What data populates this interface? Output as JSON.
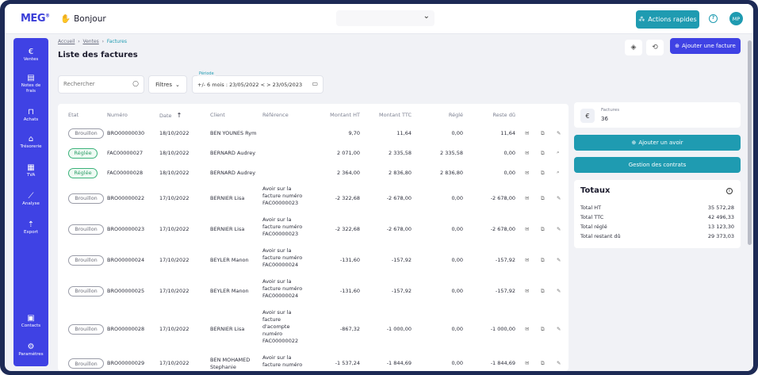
{
  "topbar": {
    "logo": "MEG",
    "greeting": "Bonjour",
    "quick_actions_label": "Actions rapides",
    "avatar_initials": "MP"
  },
  "sidebar": {
    "items": [
      {
        "label": "Ventes",
        "icon": "euro-icon",
        "glyph": "€"
      },
      {
        "label": "Notes de frais",
        "icon": "receipt-icon",
        "glyph": "▤"
      },
      {
        "label": "Achats",
        "icon": "bag-icon",
        "glyph": "⊓"
      },
      {
        "label": "Trésorerie",
        "icon": "bank-icon",
        "glyph": "⌂"
      },
      {
        "label": "TVA",
        "icon": "document-icon",
        "glyph": "▦"
      },
      {
        "label": "Analyse",
        "icon": "chart-icon",
        "glyph": "⟋"
      },
      {
        "label": "Export",
        "icon": "upload-icon",
        "glyph": "⇡"
      },
      {
        "label": "Contacts",
        "icon": "contacts-icon",
        "glyph": "▣"
      },
      {
        "label": "Paramètres",
        "icon": "settings-icon",
        "glyph": "⚙"
      }
    ]
  },
  "breadcrumb": {
    "home": "Accueil",
    "section": "Ventes",
    "current": "Factures"
  },
  "page_title": "Liste des factures",
  "add_invoice_label": "Ajouter une facture",
  "filters": {
    "search_placeholder": "Rechercher",
    "filters_label": "Filtres",
    "period_label": "Période",
    "period_value": "+/- 6 mois : 23/05/2022 < > 23/05/2023"
  },
  "table": {
    "headers": {
      "etat": "Etat",
      "numero": "Numéro",
      "date": "Date",
      "client": "Client",
      "reference": "Référence",
      "ht": "Montant HT",
      "ttc": "Montant TTC",
      "regle": "Réglé",
      "reste": "Reste dû"
    },
    "rows": [
      {
        "etat": "Brouillon",
        "status": "draft",
        "numero": "BRO00000030",
        "date": "18/10/2022",
        "client": "BEN YOUNES Rym",
        "reference": "",
        "ht": "9,70",
        "ttc": "11,64",
        "regle": "0,00",
        "reste": "11,64"
      },
      {
        "etat": "Réglée",
        "status": "paid",
        "numero": "FAC00000027",
        "date": "18/10/2022",
        "client": "BERNARD Audrey",
        "reference": "",
        "ht": "2 071,00",
        "ttc": "2 335,58",
        "regle": "2 335,58",
        "reste": "0,00"
      },
      {
        "etat": "Réglée",
        "status": "paid",
        "numero": "FAC00000028",
        "date": "18/10/2022",
        "client": "BERNARD Audrey",
        "reference": "",
        "ht": "2 364,00",
        "ttc": "2 836,80",
        "regle": "2 836,80",
        "reste": "0,00"
      },
      {
        "etat": "Brouillon",
        "status": "draft",
        "numero": "BRO00000022",
        "date": "17/10/2022",
        "client": "BERNIER Lisa",
        "reference": "Avoir sur la facture numéro FAC00000023",
        "ht": "-2 322,68",
        "ttc": "-2 678,00",
        "regle": "0,00",
        "reste": "-2 678,00"
      },
      {
        "etat": "Brouillon",
        "status": "draft",
        "numero": "BRO00000023",
        "date": "17/10/2022",
        "client": "BERNIER Lisa",
        "reference": "Avoir sur la facture numéro FAC00000023",
        "ht": "-2 322,68",
        "ttc": "-2 678,00",
        "regle": "0,00",
        "reste": "-2 678,00"
      },
      {
        "etat": "Brouillon",
        "status": "draft",
        "numero": "BRO00000024",
        "date": "17/10/2022",
        "client": "BEYLER Manon",
        "reference": "Avoir sur la facture numéro FAC00000024",
        "ht": "-131,60",
        "ttc": "-157,92",
        "regle": "0,00",
        "reste": "-157,92"
      },
      {
        "etat": "Brouillon",
        "status": "draft",
        "numero": "BRO00000025",
        "date": "17/10/2022",
        "client": "BEYLER Manon",
        "reference": "Avoir sur la facture numéro FAC00000024",
        "ht": "-131,60",
        "ttc": "-157,92",
        "regle": "0,00",
        "reste": "-157,92"
      },
      {
        "etat": "Brouillon",
        "status": "draft",
        "numero": "BRO00000028",
        "date": "17/10/2022",
        "client": "BERNIER Lisa",
        "reference": "Avoir sur la facture d'acompte numéro FAC00000022",
        "ht": "-867,32",
        "ttc": "-1 000,00",
        "regle": "0,00",
        "reste": "-1 000,00"
      },
      {
        "etat": "Brouillon",
        "status": "draft",
        "numero": "BRO00000029",
        "date": "17/10/2022",
        "client": "BEN MOHAMED Stephanie",
        "reference": "Avoir sur la facture numéro",
        "ht": "-1 537,24",
        "ttc": "-1 844,69",
        "regle": "0,00",
        "reste": "-1 844,69"
      }
    ]
  },
  "right_panel": {
    "invoices_label": "Factures",
    "invoices_count": "36",
    "add_credit_label": "Ajouter un avoir",
    "contracts_label": "Gestion des contrats",
    "totals_title": "Totaux",
    "totals": [
      {
        "label": "Total HT",
        "value": "35 572,28"
      },
      {
        "label": "Total TTC",
        "value": "42 496,33"
      },
      {
        "label": "Total réglé",
        "value": "13 123,30"
      },
      {
        "label": "Total restant dû",
        "value": "29 373,03"
      }
    ]
  }
}
